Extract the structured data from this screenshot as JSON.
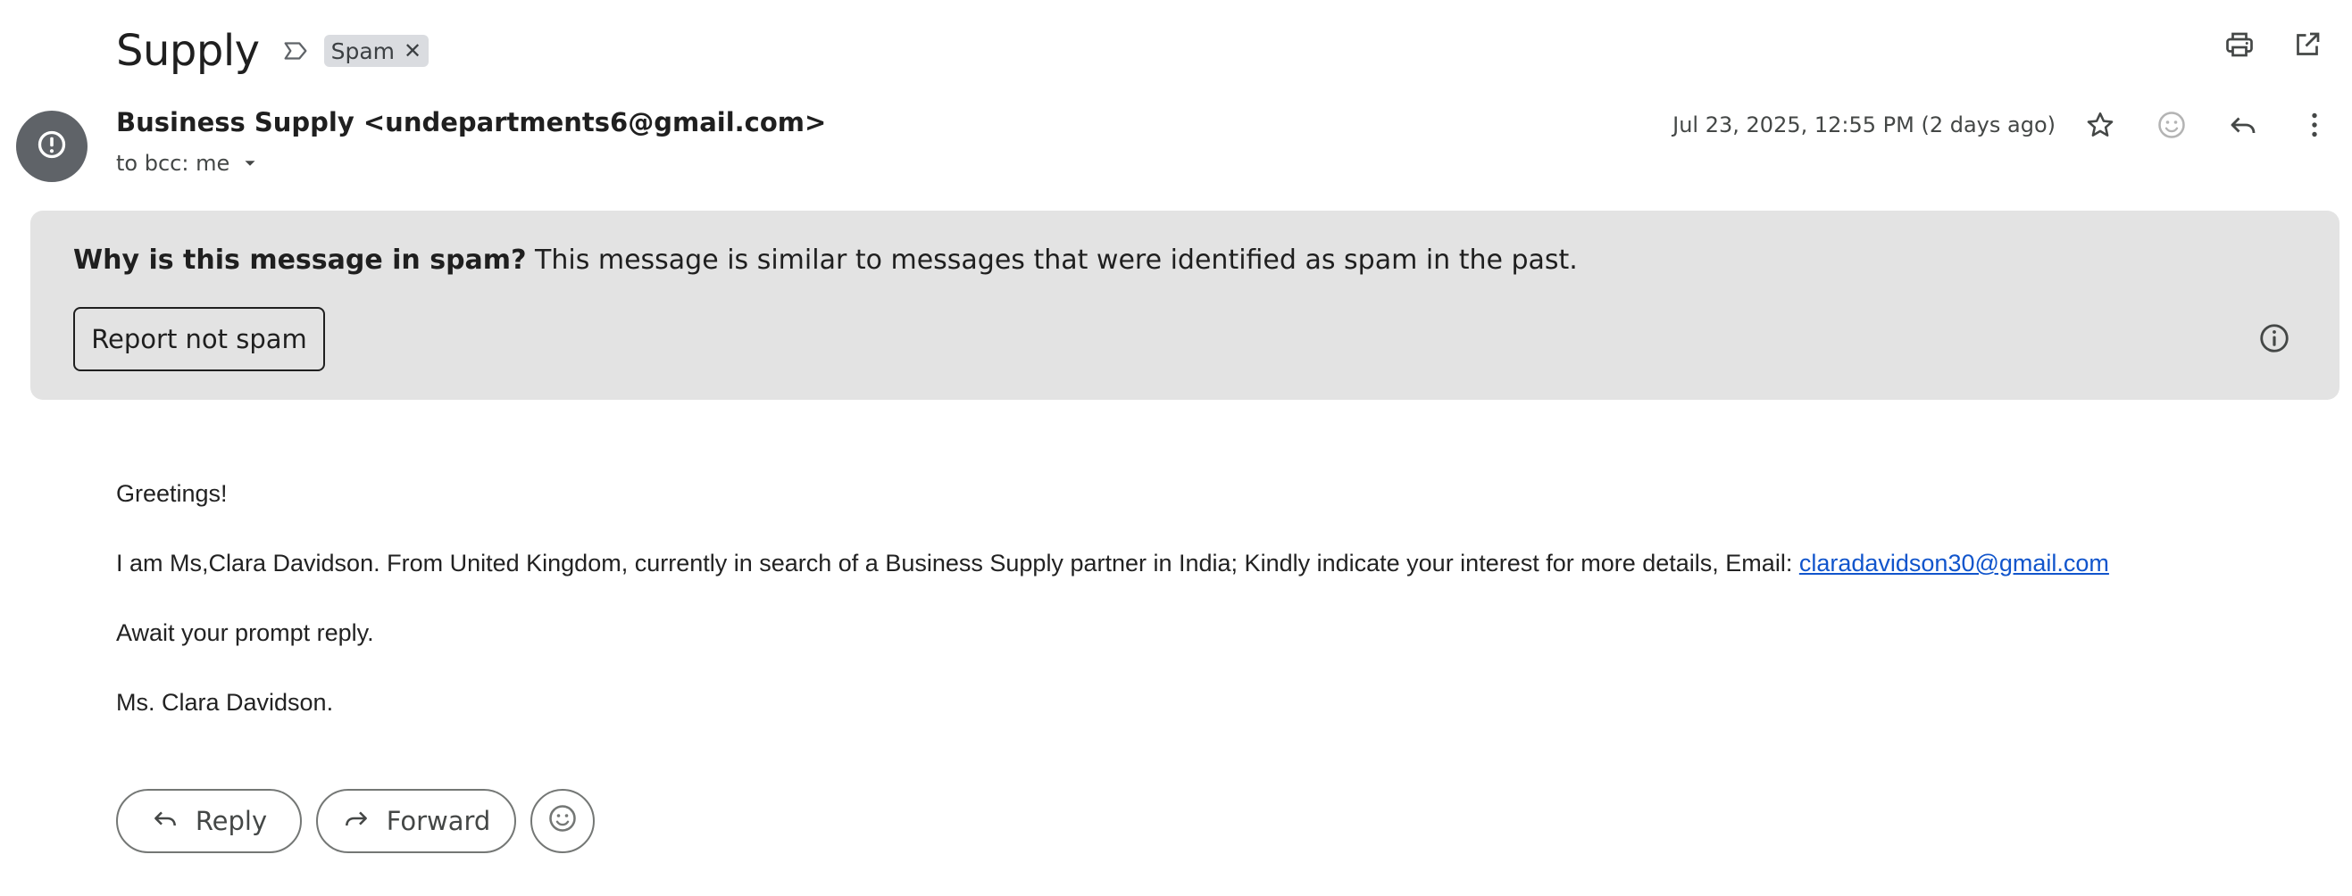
{
  "email": {
    "subject": "Supply",
    "label_chip": "Spam",
    "sender": "Business Supply <undepartments6@gmail.com>",
    "recipient": "to bcc: me",
    "date": "Jul 23, 2025, 12:55 PM (2 days ago)"
  },
  "spam_banner": {
    "question": "Why is this message in spam?",
    "explanation": "This message is similar to messages that were identified as spam in the past.",
    "button": "Report not spam"
  },
  "body": {
    "greeting": "Greetings!",
    "paragraph": "I am Ms,Clara Davidson. From United Kingdom, currently in search of a Business Supply partner in India; Kindly indicate your interest for more details, Email:",
    "email_link": "claradavidson30@gmail.com",
    "closing": "Await your prompt reply.",
    "signature": "Ms. Clara Davidson."
  },
  "actions": {
    "reply": "Reply",
    "forward": "Forward"
  },
  "icons": {
    "label_icon": "label-outline-icon",
    "chip_close": "close-icon",
    "print": "print-icon",
    "open_new_window": "open-in-new-icon",
    "avatar": "alert-circle-icon",
    "caret": "caret-down-icon",
    "star": "star-outline-icon",
    "emoji": "emoji-add-icon",
    "reply": "reply-icon",
    "more": "more-vert-icon",
    "info": "info-icon",
    "forward": "forward-icon"
  },
  "colors": {
    "banner_bg": "#e3e3e3",
    "avatar_bg": "#5f6368",
    "link": "#1155cc",
    "chip_bg": "#dadce0"
  }
}
